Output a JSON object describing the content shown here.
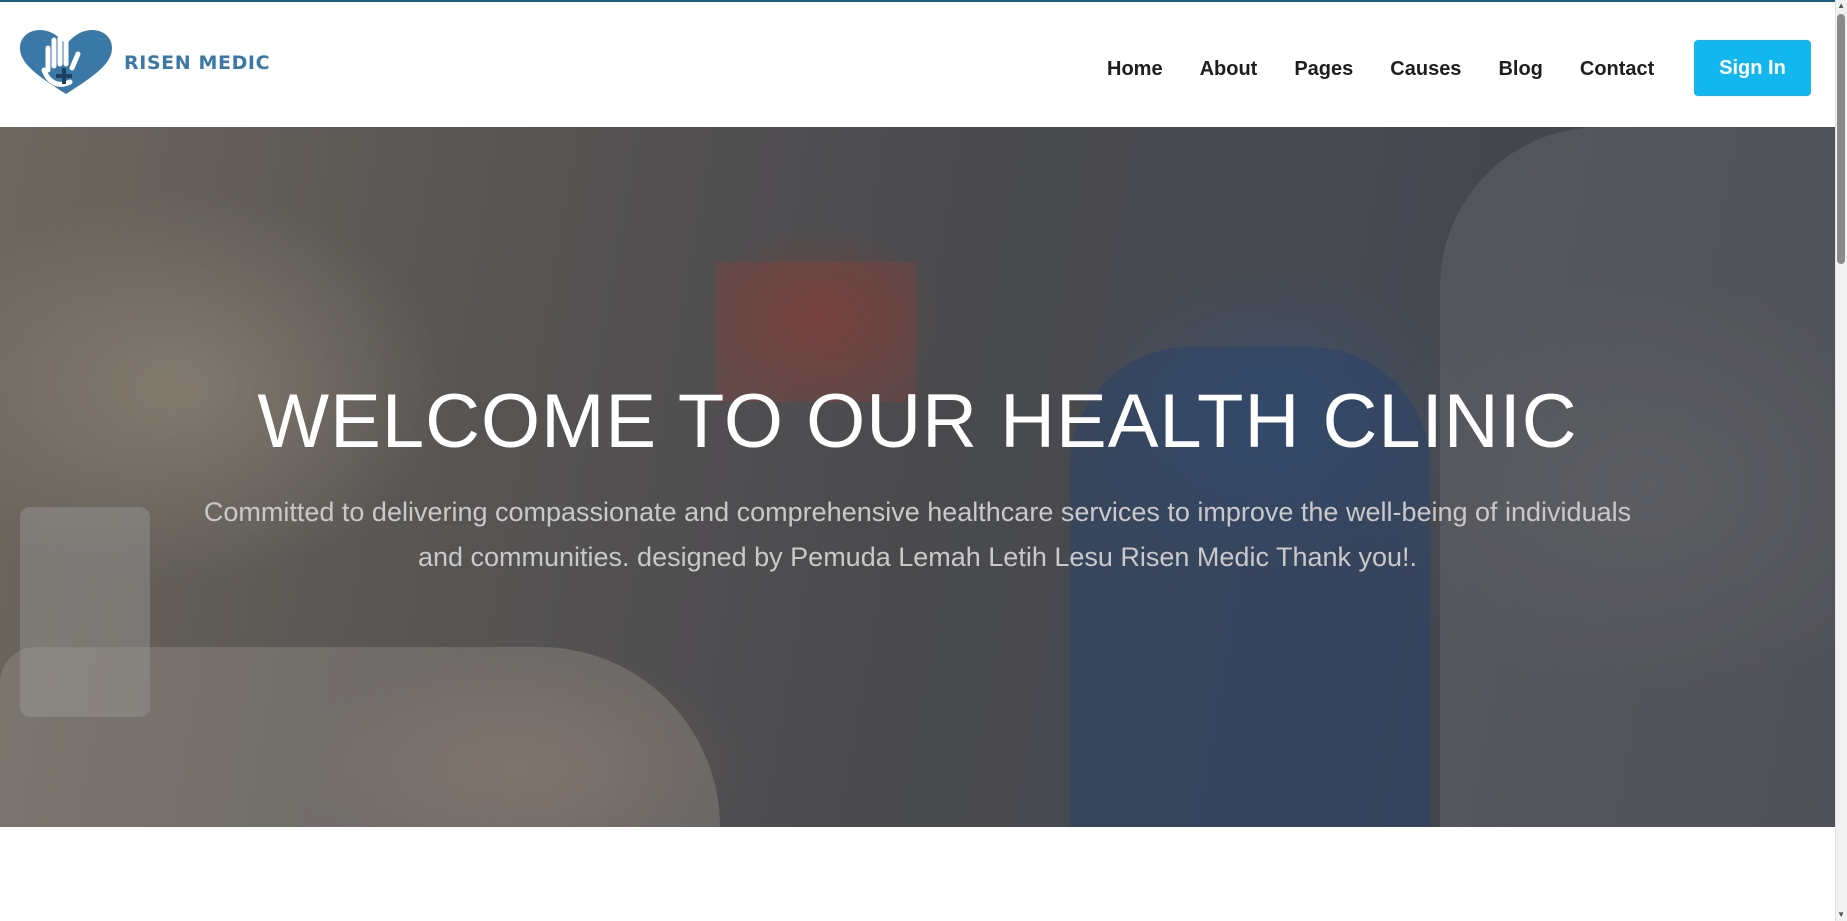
{
  "brand": {
    "name": "RISEN MEDIC",
    "logo_icon": "heart-hand-cross-icon",
    "color": "#3a78a8"
  },
  "nav": {
    "items": [
      {
        "label": "Home"
      },
      {
        "label": "About"
      },
      {
        "label": "Pages"
      },
      {
        "label": "Causes"
      },
      {
        "label": "Blog"
      },
      {
        "label": "Contact"
      }
    ],
    "signin_label": "Sign In",
    "signin_color": "#12b7f0"
  },
  "hero": {
    "title": "WELCOME TO OUR HEALTH CLINIC",
    "subtitle": "Committed to delivering compassionate and comprehensive healthcare services to improve the well-being of individuals and communities. designed by Pemuda Lemah Letih Lesu Risen Medic Thank you!."
  }
}
